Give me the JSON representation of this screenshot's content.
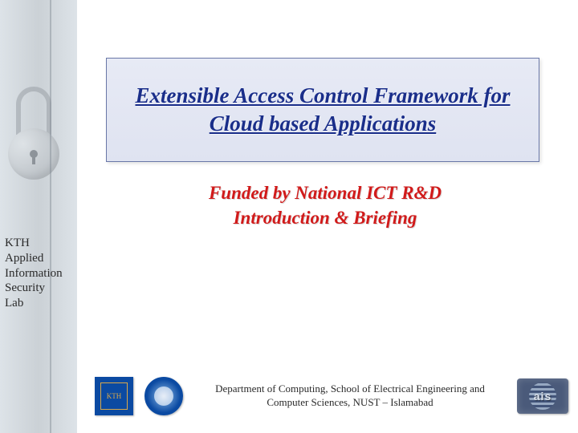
{
  "sidebar": {
    "label_line1": "KTH",
    "label_line2": "Applied",
    "label_line3": "Information",
    "label_line4": "Security",
    "label_line5": "Lab"
  },
  "title": "Extensible Access Control Framework for Cloud based Applications",
  "subtitle": {
    "line1": "Funded by National ICT R&D",
    "line2": "Introduction & Briefing"
  },
  "footer": {
    "kth_abbrev": "KTH",
    "dept": "Department of Computing, School of Electrical Engineering and Computer Sciences, NUST – Islamabad",
    "ais_abbrev": "ais"
  }
}
